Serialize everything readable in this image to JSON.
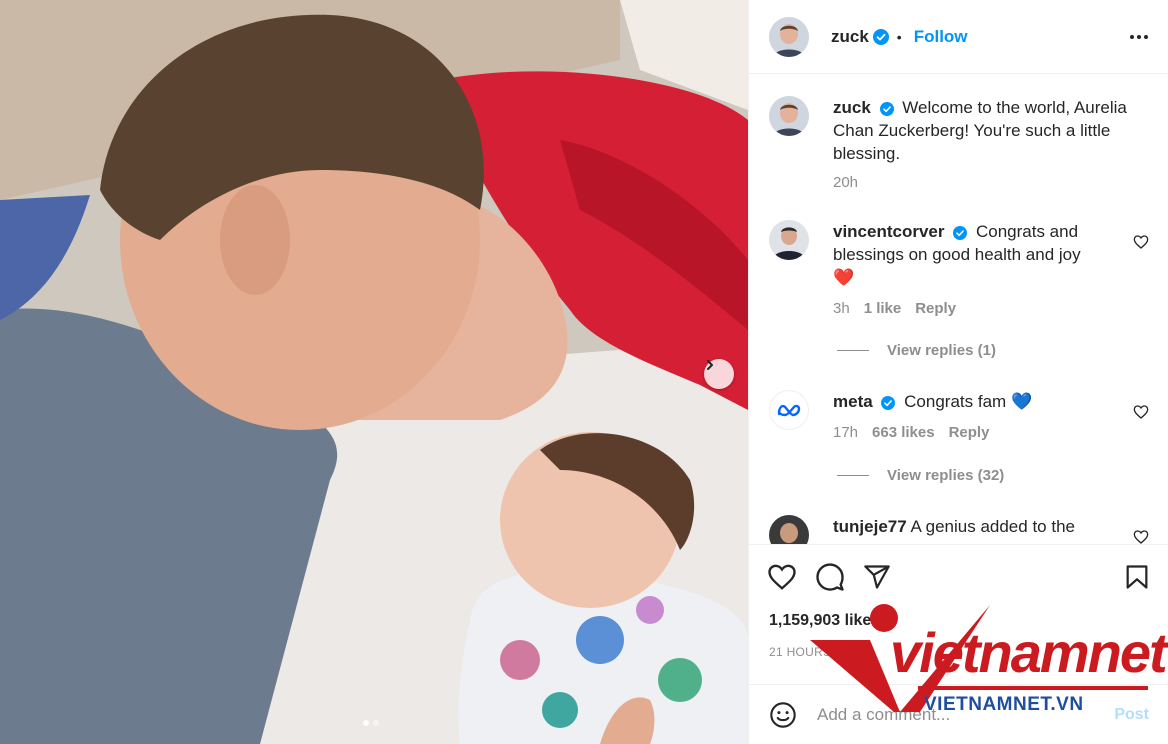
{
  "post": {
    "author": "zuck",
    "follow_label": "Follow",
    "separator": "•",
    "caption": {
      "username": "zuck",
      "text": "Welcome to the world, Aurelia Chan Zuckerberg! You're such a little blessing.",
      "time": "20h"
    },
    "comments": [
      {
        "username": "vincentcorver",
        "verified": true,
        "text": "Congrats and blessings on good health and joy",
        "emoji": "❤️",
        "time": "3h",
        "likes": "1 like",
        "reply_label": "Reply",
        "view_replies": "View replies (1)"
      },
      {
        "username": "meta",
        "verified": true,
        "text": "Congrats fam",
        "emoji": "💙",
        "time": "17h",
        "likes": "663 likes",
        "reply_label": "Reply",
        "view_replies": "View replies (32)"
      },
      {
        "username": "tunjeje77",
        "verified": false,
        "text": "A genius added to the"
      }
    ],
    "likes_count": "1,159,903 like",
    "timestamp": "21 HOURS",
    "add_comment_placeholder": "Add a comment...",
    "post_label": "Post"
  },
  "carousel": {
    "current": 1,
    "total": 2
  },
  "watermark": {
    "word": "vietnamnet",
    "domain": "VIETNAMNET.VN"
  },
  "colors": {
    "link": "#0095f6",
    "verified": "#0095f6",
    "heart": "#ed4956",
    "watermark_red": "#cc1b20",
    "watermark_blue": "#1d4ea1"
  },
  "icons": [
    "chevron-right-icon",
    "verified-badge-icon",
    "more-icon",
    "heart-outline-icon",
    "comment-icon",
    "share-icon",
    "bookmark-icon",
    "emoji-icon",
    "meta-logo-icon"
  ]
}
